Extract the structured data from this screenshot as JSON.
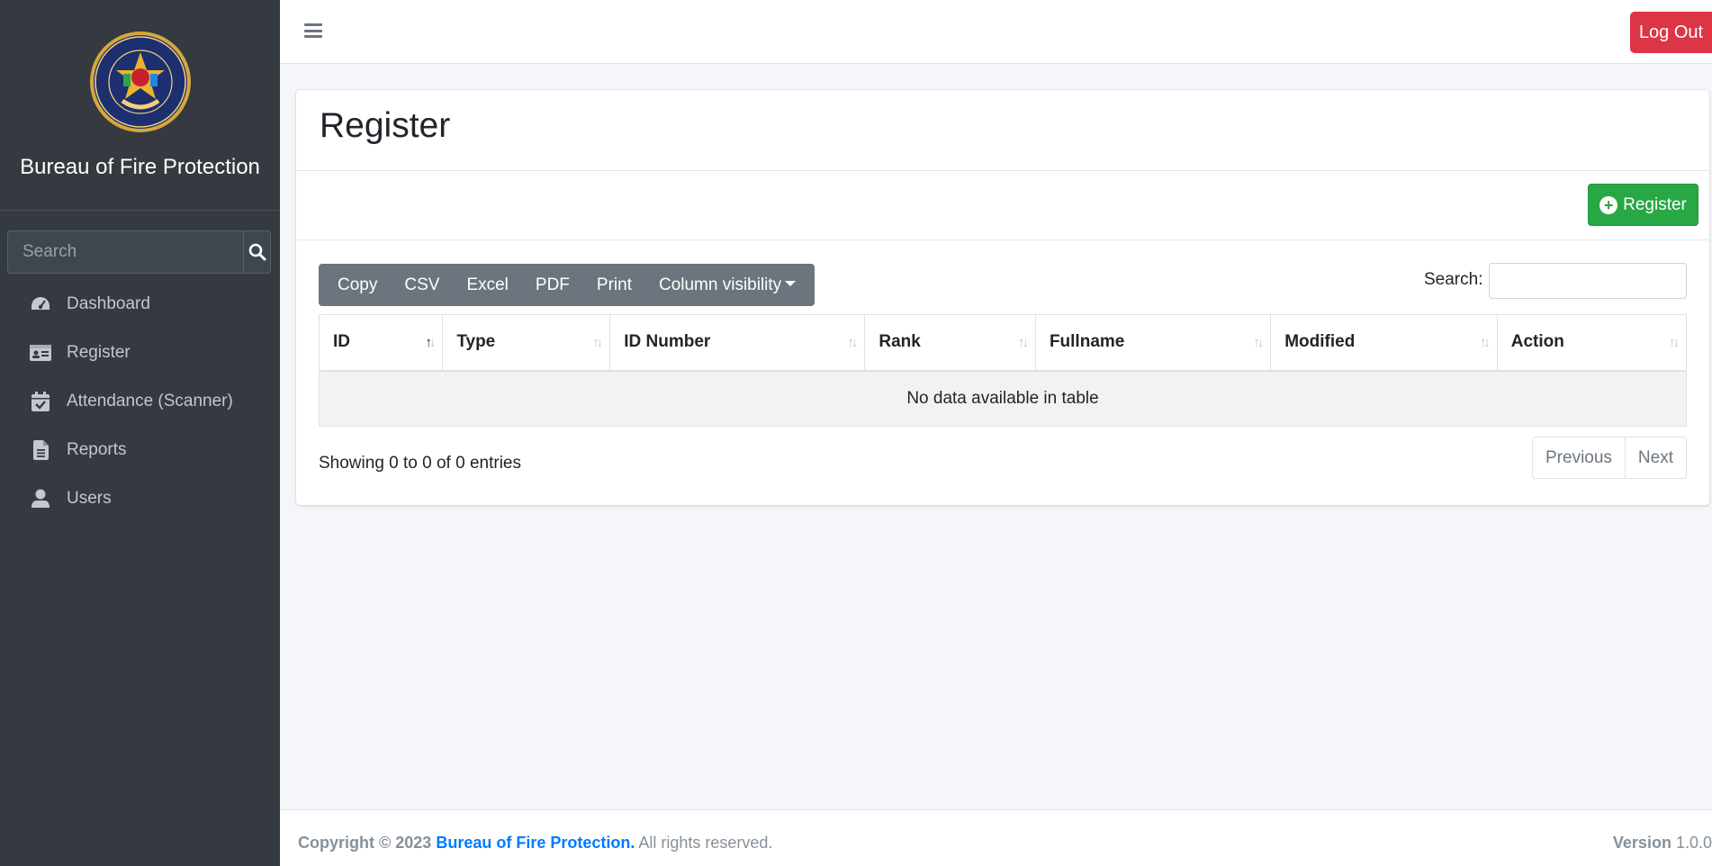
{
  "sidebar": {
    "brand": "Bureau of Fire Protection",
    "search_placeholder": "Search",
    "items": [
      {
        "label": "Dashboard",
        "icon": "tachometer-icon"
      },
      {
        "label": "Register",
        "icon": "id-card-icon"
      },
      {
        "label": "Attendance (Scanner)",
        "icon": "calendar-check-icon"
      },
      {
        "label": "Reports",
        "icon": "file-alt-icon"
      },
      {
        "label": "Users",
        "icon": "user-icon"
      }
    ]
  },
  "topbar": {
    "logout_label": "Log Out"
  },
  "page": {
    "title": "Register",
    "register_button": "Register"
  },
  "toolbar": {
    "buttons": [
      "Copy",
      "CSV",
      "Excel",
      "PDF",
      "Print",
      "Column visibility"
    ]
  },
  "search": {
    "label": "Search:",
    "value": ""
  },
  "table": {
    "columns": [
      "ID",
      "Type",
      "ID Number",
      "Rank",
      "Fullname",
      "Modified",
      "Action"
    ],
    "empty_message": "No data available in table",
    "info": "Showing 0 to 0 of 0 entries"
  },
  "pagination": {
    "previous": "Previous",
    "next": "Next"
  },
  "footer": {
    "copyright": "Copyright © 2023",
    "org": "Bureau of Fire Protection.",
    "rights": "All rights reserved.",
    "version_label": "Version",
    "version": "1.0.0"
  },
  "colors": {
    "sidebar": "#343a40",
    "success": "#28a745",
    "danger": "#dc3545",
    "link": "#007bff",
    "secondary": "#6c757d"
  }
}
